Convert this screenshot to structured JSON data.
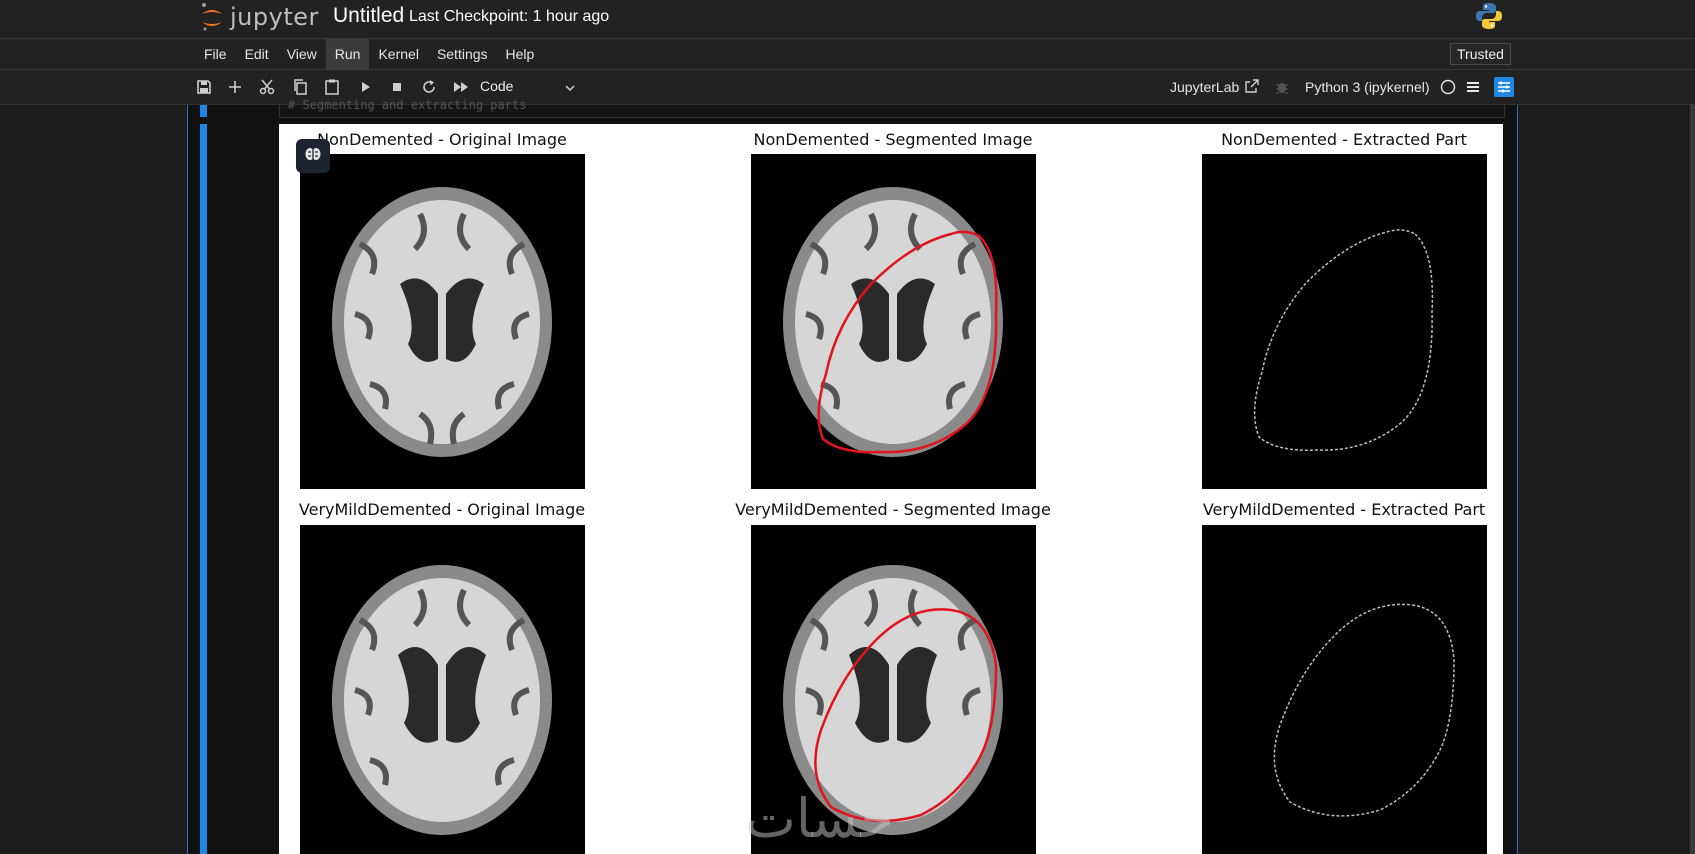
{
  "header": {
    "logo_text": "jupyter",
    "notebook_title": "Untitled",
    "checkpoint": "Last Checkpoint: 1 hour ago",
    "trusted": "Trusted"
  },
  "menu": [
    "File",
    "Edit",
    "View",
    "Run",
    "Kernel",
    "Settings",
    "Help"
  ],
  "active_menu": "Run",
  "toolbar": {
    "cell_type": "Code",
    "jupyterlab_link": "JupyterLab",
    "kernel": "Python 3 (ipykernel)",
    "icons": [
      "save-icon",
      "add-cell-icon",
      "cut-icon",
      "copy-icon",
      "paste-icon",
      "run-icon",
      "stop-icon",
      "restart-icon",
      "fast-forward-icon"
    ]
  },
  "prev_cell_text": "# Segmenting and extracting parts",
  "output": {
    "row1": {
      "original": "NonDemented - Original Image",
      "segmented": "NonDemented - Segmented Image",
      "extracted": "NonDemented - Extracted Part"
    },
    "row2": {
      "original": "VeryMildDemented - Original Image",
      "segmented": "VeryMildDemented - Segmented Image",
      "extracted": "VeryMildDemented - Extracted Part"
    }
  },
  "watermark": "حسات",
  "colors": {
    "accent": "#1e88e5",
    "segment_contour": "#e0141e",
    "background": "#1c1c1c"
  }
}
